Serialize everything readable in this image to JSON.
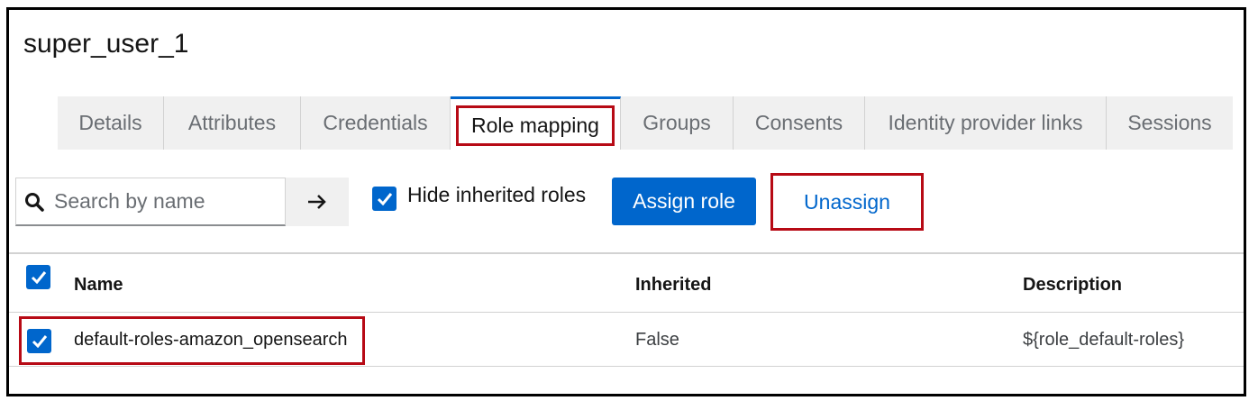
{
  "page": {
    "title": "super_user_1"
  },
  "tabs": [
    {
      "label": "Details",
      "active": false
    },
    {
      "label": "Attributes",
      "active": false
    },
    {
      "label": "Credentials",
      "active": false
    },
    {
      "label": "Role mapping",
      "active": true
    },
    {
      "label": "Groups",
      "active": false
    },
    {
      "label": "Consents",
      "active": false
    },
    {
      "label": "Identity provider links",
      "active": false
    },
    {
      "label": "Sessions",
      "active": false
    }
  ],
  "toolbar": {
    "search_placeholder": "Search by name",
    "search_value": "",
    "search_go_icon": "arrow-right-icon",
    "hide_inherited_label": "Hide inherited roles",
    "hide_inherited_checked": true,
    "assign_label": "Assign role",
    "unassign_label": "Unassign"
  },
  "table": {
    "columns": [
      "Name",
      "Inherited",
      "Description"
    ],
    "select_all_checked": true,
    "rows": [
      {
        "selected": true,
        "name": "default-roles-amazon_opensearch",
        "inherited": "False",
        "description": "${role_default-roles}"
      }
    ]
  },
  "colors": {
    "accent": "#0066cc",
    "highlight": "#b70a15",
    "tab_bg": "#f0f0f0"
  }
}
